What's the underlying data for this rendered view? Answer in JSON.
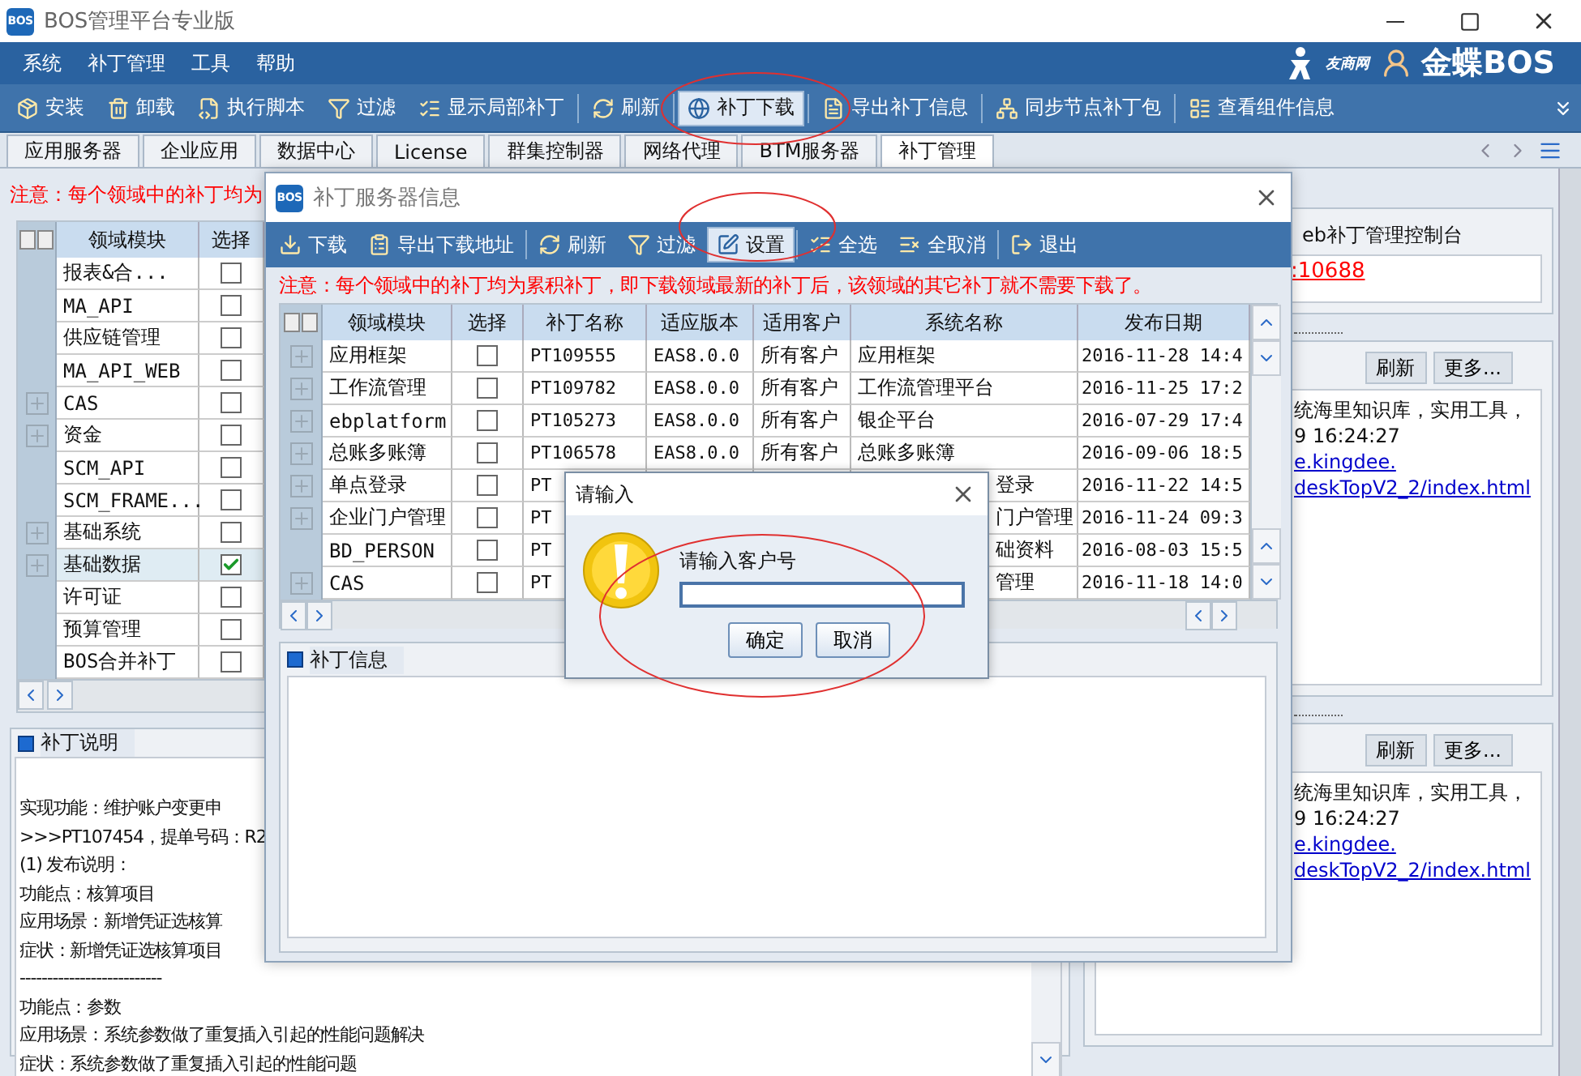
{
  "window": {
    "logo": "BOS",
    "title": "BOS管理平台专业版"
  },
  "menu": [
    "系统",
    "补丁管理",
    "工具",
    "帮助"
  ],
  "brand": {
    "site": "友商网",
    "name": "金蝶BOS"
  },
  "toolbar": [
    {
      "label": "安装",
      "kind": "install",
      "selected": false
    },
    {
      "label": "卸载",
      "kind": "uninstall",
      "selected": false
    },
    {
      "label": "执行脚本",
      "kind": "script",
      "selected": false
    },
    {
      "label": "过滤",
      "kind": "filter",
      "selected": false
    },
    {
      "label": "显示局部补丁",
      "kind": "partial",
      "selected": false
    },
    {
      "label": "刷新",
      "kind": "refresh",
      "selected": false
    },
    {
      "label": "补丁下载",
      "kind": "download",
      "selected": true
    },
    {
      "label": "导出补丁信息",
      "kind": "export",
      "selected": false
    },
    {
      "label": "同步节点补丁包",
      "kind": "sync",
      "selected": false
    },
    {
      "label": "查看组件信息",
      "kind": "components",
      "selected": false
    }
  ],
  "tabs": [
    {
      "label": "应用服务器",
      "selected": false
    },
    {
      "label": "企业应用",
      "selected": false
    },
    {
      "label": "数据中心",
      "selected": false
    },
    {
      "label": "License",
      "selected": false
    },
    {
      "label": "群集控制器",
      "selected": false
    },
    {
      "label": "网络代理",
      "selected": false
    },
    {
      "label": "BTM服务器",
      "selected": false
    },
    {
      "label": "补丁管理",
      "selected": true
    }
  ],
  "notice": "注意：每个领域中的补丁均为",
  "module_table": {
    "columns": [
      "领域模块",
      "选择"
    ],
    "rows": [
      {
        "module": "报表&合...",
        "checked": false,
        "selected": false,
        "expandable": false
      },
      {
        "module": "MA_API",
        "checked": false,
        "selected": false,
        "expandable": false
      },
      {
        "module": "供应链管理",
        "checked": false,
        "selected": false,
        "expandable": false
      },
      {
        "module": "MA_API_WEB",
        "checked": false,
        "selected": false,
        "expandable": false
      },
      {
        "module": "CAS",
        "checked": false,
        "selected": false,
        "expandable": true
      },
      {
        "module": "资金",
        "checked": false,
        "selected": false,
        "expandable": true
      },
      {
        "module": "SCM_API",
        "checked": false,
        "selected": false,
        "expandable": false
      },
      {
        "module": "SCM_FRAME...",
        "checked": false,
        "selected": false,
        "expandable": false
      },
      {
        "module": "基础系统",
        "checked": false,
        "selected": false,
        "expandable": true
      },
      {
        "module": "基础数据",
        "checked": true,
        "selected": true,
        "expandable": true
      },
      {
        "module": "许可证",
        "checked": false,
        "selected": false,
        "expandable": false
      },
      {
        "module": "预算管理",
        "checked": false,
        "selected": false,
        "expandable": false
      },
      {
        "module": "BOS合并补丁",
        "checked": false,
        "selected": false,
        "expandable": false
      }
    ]
  },
  "patch_description": {
    "title": "补丁说明",
    "lines": [
      "实现功能：维护账户变更申",
      ">>>PT107454，提单号码：R2",
      "(1) 发布说明：",
      "功能点：核算项目",
      "应用场景：新增凭证选核算",
      "症状：新增凭证选核算项目",
      "--------------------------",
      "功能点：参数",
      "应用场景：系统参数做了重复插入引起的性能问题解决",
      "症状：系统参数做了重复插入引起的性能问题"
    ]
  },
  "right_panel": {
    "console_title": "eb补丁管理控制台",
    "console_link": ":10688",
    "sections": [
      {
        "buttons": [
          "刷新",
          "更多..."
        ],
        "lines": [
          {
            "text": "统海里知识库，实用工具，",
            "kind": "text"
          },
          {
            "text": "9 16:24:27",
            "kind": "text"
          },
          {
            "text": "e.kingdee.",
            "kind": "link"
          },
          {
            "text": "deskTopV2_2/index.html",
            "kind": "link"
          }
        ]
      },
      {
        "buttons": [
          "刷新",
          "更多..."
        ],
        "lines": [
          {
            "text": "统海里知识库，实用工具，",
            "kind": "text"
          },
          {
            "text": "9 16:24:27",
            "kind": "text"
          },
          {
            "text": "e.kingdee.",
            "kind": "link"
          },
          {
            "text": "deskTopV2_2/index.html",
            "kind": "link"
          }
        ]
      }
    ]
  },
  "server_dialog": {
    "logo": "BOS",
    "title": "补丁服务器信息",
    "toolbar": [
      {
        "label": "下载",
        "kind": "download",
        "selected": false
      },
      {
        "label": "导出下载地址",
        "kind": "export",
        "selected": false
      },
      {
        "label": "刷新",
        "kind": "refresh",
        "selected": false
      },
      {
        "label": "过滤",
        "kind": "filter",
        "selected": false
      },
      {
        "label": "设置",
        "kind": "settings",
        "selected": true
      },
      {
        "label": "全选",
        "kind": "select_all",
        "selected": false
      },
      {
        "label": "全取消",
        "kind": "deselect_all",
        "selected": false
      },
      {
        "label": "退出",
        "kind": "exit",
        "selected": false
      }
    ],
    "notice": "注意：每个领域中的补丁均为累积补丁，即下载领域最新的补丁后，该领域的其它补丁就不需要下载了。",
    "table": {
      "columns": [
        "领域模块",
        "选择",
        "补丁名称",
        "适应版本",
        "适用客户",
        "系统名称",
        "发布日期"
      ],
      "rows": [
        {
          "module": "应用框架",
          "checked": false,
          "expandable": true,
          "patch": "PT109555",
          "version": "EAS8.0.0",
          "customer": "所有客户",
          "system": "应用框架",
          "date": "2016-11-28 14:4"
        },
        {
          "module": "工作流管理",
          "checked": false,
          "expandable": true,
          "patch": "PT109782",
          "version": "EAS8.0.0",
          "customer": "所有客户",
          "system": "工作流管理平台",
          "date": "2016-11-25 17:2"
        },
        {
          "module": "ebplatform",
          "checked": false,
          "expandable": true,
          "patch": "PT105273",
          "version": "EAS8.0.0",
          "customer": "所有客户",
          "system": "银企平台",
          "date": "2016-07-29 17:4"
        },
        {
          "module": "总账多账簿",
          "checked": false,
          "expandable": true,
          "patch": "PT106578",
          "version": "EAS8.0.0",
          "customer": "所有客户",
          "system": "总账多账簿",
          "date": "2016-09-06 18:5"
        },
        {
          "module": "单点登录",
          "checked": false,
          "expandable": true,
          "patch": "PT",
          "system": "登录",
          "date": "2016-11-22 14:5"
        },
        {
          "module": "企业门户管理",
          "checked": false,
          "expandable": true,
          "patch": "PT",
          "system": "门户管理",
          "date": "2016-11-24 09:3"
        },
        {
          "module": "BD_PERSON",
          "checked": false,
          "expandable": false,
          "patch": "PT",
          "system": "础资料",
          "date": "2016-08-03 15:5"
        },
        {
          "module": "CAS",
          "checked": false,
          "expandable": true,
          "patch": "PT",
          "system": "管理",
          "date": "2016-11-18 14:0"
        }
      ]
    },
    "info_title": "补丁信息"
  },
  "input_dialog": {
    "title": "请输入",
    "prompt": "请输入客户号",
    "buttons": [
      "确定",
      "取消"
    ]
  }
}
